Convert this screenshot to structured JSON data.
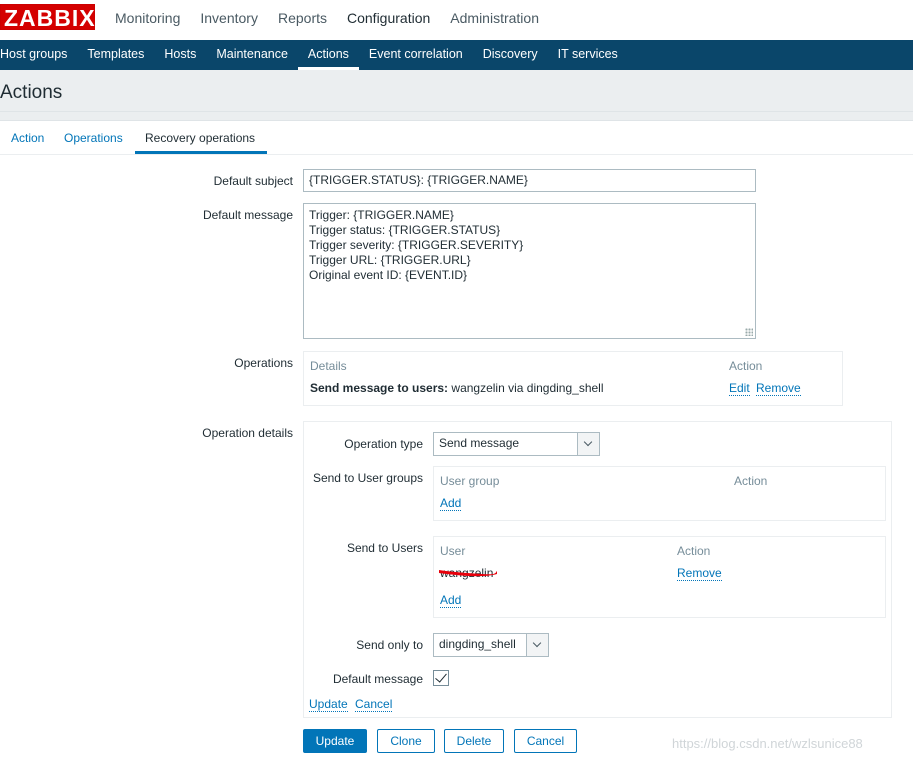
{
  "brand": {
    "logo_text": "ZABBIX",
    "logo_color": "#d40000"
  },
  "top_menu": [
    "Monitoring",
    "Inventory",
    "Reports",
    "Configuration",
    "Administration"
  ],
  "sub_menu": [
    "Host groups",
    "Templates",
    "Hosts",
    "Maintenance",
    "Actions",
    "Event correlation",
    "Discovery",
    "IT services"
  ],
  "page_title": "Actions",
  "tabs": [
    "Action",
    "Operations",
    "Recovery operations"
  ],
  "form": {
    "default_subject_label": "Default subject",
    "default_subject_value": "{TRIGGER.STATUS}: {TRIGGER.NAME}",
    "default_message_label": "Default message",
    "default_message_value": "Trigger: {TRIGGER.NAME}\nTrigger status: {TRIGGER.STATUS}\nTrigger severity: {TRIGGER.SEVERITY}\nTrigger URL: {TRIGGER.URL}\nOriginal event ID: {EVENT.ID}",
    "operations_label": "Operations",
    "operations_table": {
      "col_details": "Details",
      "col_action": "Action",
      "row_bold": "Send message to users:",
      "row_rest": " wangzelin via dingding_shell",
      "edit": "Edit",
      "remove": "Remove"
    },
    "operation_details_label": "Operation details"
  },
  "details": {
    "operation_type_label": "Operation type",
    "operation_type_value": "Send message",
    "send_to_groups_label": "Send to User groups",
    "groups_col_group": "User group",
    "groups_col_action": "Action",
    "groups_add": "Add",
    "send_to_users_label": "Send to Users",
    "users_col_user": "User",
    "users_col_action": "Action",
    "user_name": "wangzelin",
    "user_remove": "Remove",
    "users_add": "Add",
    "send_only_to_label": "Send only to",
    "send_only_to_value": "dingding_shell",
    "default_message_label": "Default message",
    "update_link": "Update",
    "cancel_link": "Cancel"
  },
  "buttons": {
    "update": "Update",
    "clone": "Clone",
    "delete": "Delete",
    "cancel": "Cancel"
  },
  "watermark": "https://blog.csdn.net/wzlsunice88",
  "colors": {
    "nav_bar": "#0a466a",
    "link": "#0275b8",
    "redaction": "#e8000b"
  }
}
